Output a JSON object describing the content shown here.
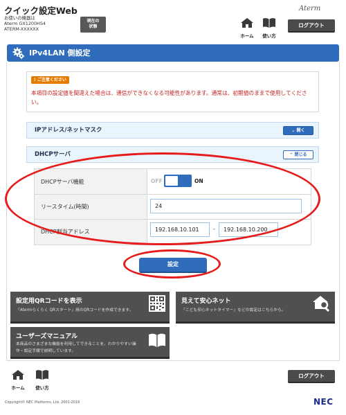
{
  "header": {
    "title": "クイック設定Web",
    "device_label": "お使いの機器は",
    "device_model": "Aterm GX1200HS4",
    "device_id": "ATERM-XXXXXX",
    "status_button_line1": "現在の",
    "status_button_line2": "状態",
    "brand": "Aterm",
    "home_label": "ホーム",
    "manual_label": "使い方",
    "logout_label": "ログアウト"
  },
  "page": {
    "title": "IPv4LAN 側設定"
  },
  "notice": {
    "badge": "ご注意ください",
    "text": "本項目の設定値を間違えた場合は、通信ができなくなる可能性があります。通常は、初期値のままで使用してください。"
  },
  "sections": [
    {
      "title": "IPアドレス/ネットマスク",
      "button": "開く",
      "state": "collapsed"
    },
    {
      "title": "DHCPサーバ",
      "button": "閉じる",
      "state": "expanded"
    }
  ],
  "dhcp": {
    "server_label": "DHCPサーバ機能",
    "toggle_off": "OFF",
    "toggle_on": "ON",
    "toggle_state": "on",
    "lease_label": "リースタイム(時間)",
    "lease_value": "24",
    "range_label": "DHCP割当アドレス",
    "range_start": "192.168.10.101",
    "range_sep": "-",
    "range_end": "192.168.10.200"
  },
  "save_label": "設定",
  "links": [
    {
      "title": "設定用QRコードを表示",
      "desc": "「Atermらくらく QRスタート」用のQRコードを作成できます。",
      "icon": "qr-code-icon"
    },
    {
      "title": "見えて安心ネット",
      "desc": "「こども安心ネットタイマー」などの設定はこちらから。",
      "icon": "home-search-icon"
    },
    {
      "title": "ユーザーズマニュアル",
      "desc_line1": "本商品のさまざまな機能を利用してできることを、わかりやすい操",
      "desc_line2": "作・設定手順で説明しています。",
      "icon": "book-icon"
    }
  ],
  "footer": {
    "home_label": "ホーム",
    "manual_label": "使い方",
    "logout_label": "ログアウト",
    "copyright": "Copyright© NEC Platforms, Ltd. 2001-2019",
    "logo": "NEC"
  },
  "colors": {
    "primary_blue": "#2f6dbc",
    "warning_red": "#c81e1e",
    "annotation_red": "#e61b1b",
    "badge_orange": "#e67a00"
  }
}
